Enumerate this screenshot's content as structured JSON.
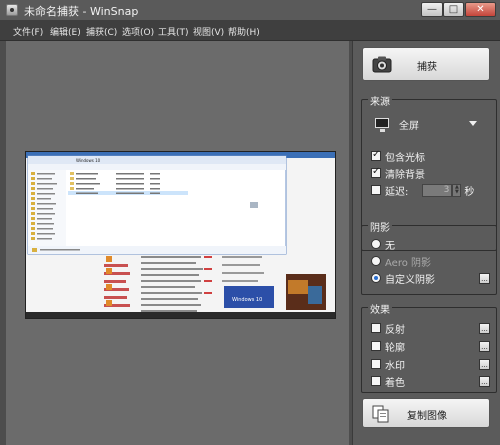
{
  "window": {
    "title": "未命名捕获 - WinSnap",
    "controls": {
      "min": "—",
      "max": "□",
      "close": "✕"
    }
  },
  "menu": [
    "文件(F)",
    "编辑(E)",
    "捕获(C)",
    "选项(O)",
    "工具(T)",
    "视图(V)",
    "帮助(H)"
  ],
  "capture_button": {
    "label": "捕获",
    "icon": "camera-icon"
  },
  "source": {
    "title": "来源",
    "mode": "全屏",
    "mode_icon": "monitor-icon",
    "include_cursor": {
      "label": "包含光标",
      "checked": true
    },
    "clear_background": {
      "label": "清除背景",
      "checked": true
    },
    "delay": {
      "label": "延迟:",
      "checked": false,
      "value": "3",
      "unit": "秒"
    }
  },
  "shadow": {
    "title": "阴影",
    "none_label": "无",
    "aero_label": "Aero 阴影",
    "custom_label": "自定义阴影",
    "selected": "custom"
  },
  "effects": {
    "title": "效果",
    "items": [
      {
        "label": "反射",
        "checked": false
      },
      {
        "label": "轮廓",
        "checked": false
      },
      {
        "label": "水印",
        "checked": false
      },
      {
        "label": "着色",
        "checked": false
      }
    ]
  },
  "copy_button": {
    "label": "复制图像",
    "icon": "copy-image-icon"
  },
  "preview": {
    "window_title": "Windows 10",
    "thumbnail_caption": "Windows 10"
  }
}
